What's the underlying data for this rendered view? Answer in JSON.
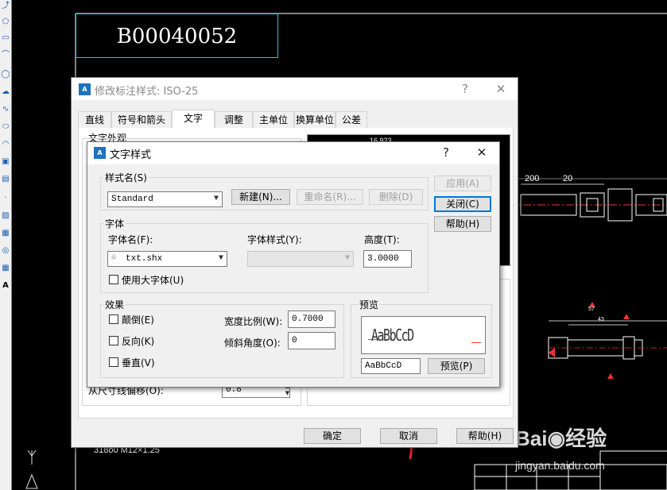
{
  "drawing": {
    "part_number": "B00040052",
    "dim_16923": "16.923",
    "dim_200": "200",
    "dim_20": "20",
    "dim_bottom": "318ö0 M12×1.25",
    "dim_57": "57",
    "dim_43": "43"
  },
  "watermark": {
    "brand": "Bai◉经验",
    "url": "jingyan.baidu.com"
  },
  "outer_dialog": {
    "title": "修改标注样式: ISO-25",
    "help": "?",
    "close": "✕",
    "tabs": [
      "直线",
      "符号和箭头",
      "文字",
      "调整",
      "主单位",
      "换算单位",
      "公差"
    ],
    "active_tab": "文字",
    "section_appearance": "文字外观",
    "offset_label": "从尺寸线偏移(O):",
    "offset_value": "0.8",
    "ok": "确定",
    "cancel": "取消",
    "help_btn": "帮助(H)"
  },
  "text_style_dialog": {
    "title": "文字样式",
    "help": "?",
    "close": "✕",
    "style_name_group": "样式名(S)",
    "style_name_value": "Standard",
    "new_btn": "新建(N)...",
    "rename_btn": "重命名(R)...",
    "delete_btn": "删除(D)",
    "apply_btn": "应用(A)",
    "close_btn": "关闭(C)",
    "help_btn": "帮助(H)",
    "font_group": "字体",
    "font_name_label": "字体名(F):",
    "font_name_value": "txt.shx",
    "font_style_label": "字体样式(Y):",
    "height_label": "高度(T):",
    "height_value": "3.0000",
    "big_font_label": "使用大字体(U)",
    "effects_group": "效果",
    "upside_down": "颠倒(E)",
    "backwards": "反向(K)",
    "vertical": "垂直(V)",
    "width_factor_label": "宽度比例(W):",
    "width_factor_value": "0.7000",
    "oblique_label": "倾斜角度(O):",
    "oblique_value": "0",
    "preview_group": "预览",
    "preview_text": "AaBbCcD",
    "preview_input": "AaBbCcD",
    "preview_btn": "预览(P)"
  },
  "colors": {
    "annotation_arrow": "#e8202a",
    "cad_cyan": "#2bc4c4",
    "focus": "#0078d7"
  }
}
